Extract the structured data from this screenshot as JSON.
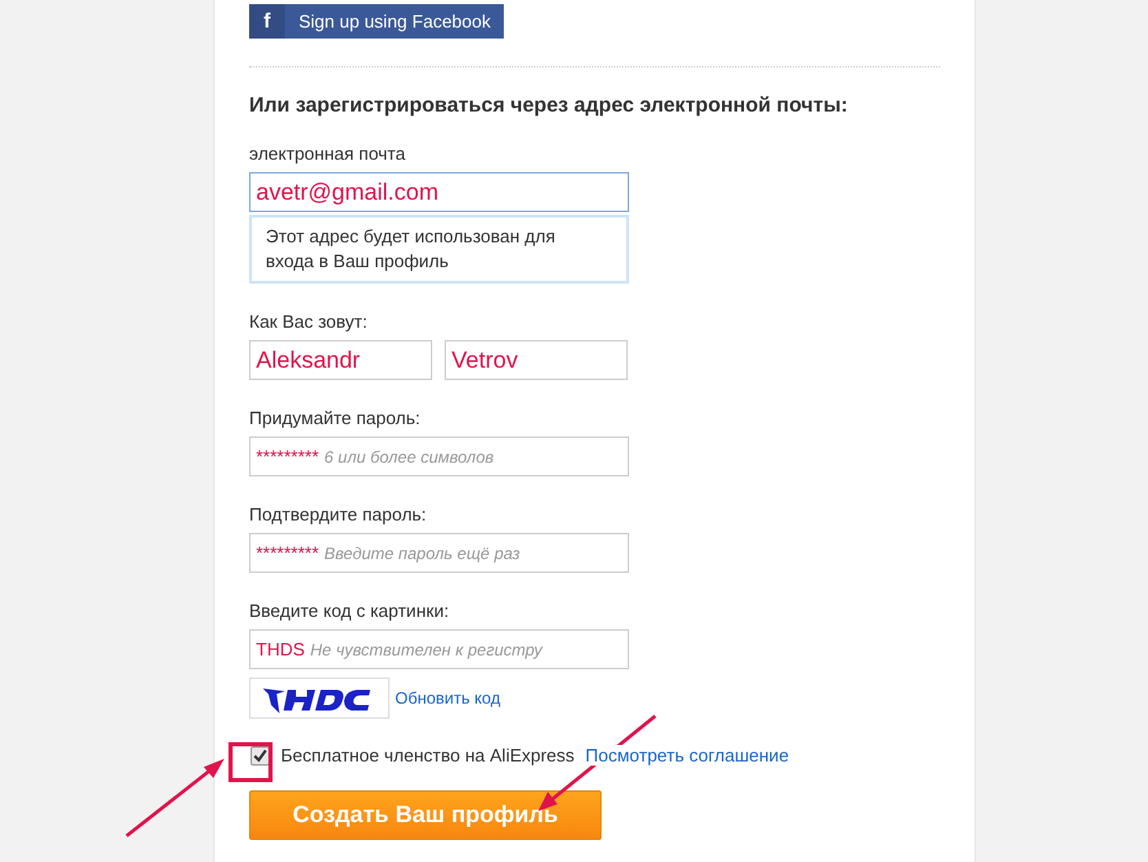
{
  "facebook_button": {
    "icon": "f",
    "label": "Sign up using Facebook"
  },
  "heading": "Или зарегистрироваться через адрес электронной почты:",
  "email": {
    "label": "электронная почта",
    "value": "avetr@gmail.com",
    "hint": "Этот адрес будет использован для входа в Ваш профиль"
  },
  "name": {
    "label": "Как Вас зовут:",
    "fields": [
      {
        "value": "Aleksandr"
      },
      {
        "value": "Vetrov"
      }
    ]
  },
  "password": {
    "label": "Придумайте пароль:",
    "value": "*********",
    "placeholder": "6 или более символов"
  },
  "confirm_password": {
    "label": "Подтвердите пароль:",
    "value": "*********",
    "placeholder": "Введите пароль ещё раз"
  },
  "captcha": {
    "label": "Введите код с картинки:",
    "value": "THDS",
    "placeholder": "Не чувствителен к регистру",
    "refresh_link": "Обновить код"
  },
  "agreement": {
    "checked": true,
    "label": "Бесплатное членство на AliExpress",
    "link": "Посмотреть соглашение"
  },
  "submit_button": "Создать Ваш профиль"
}
